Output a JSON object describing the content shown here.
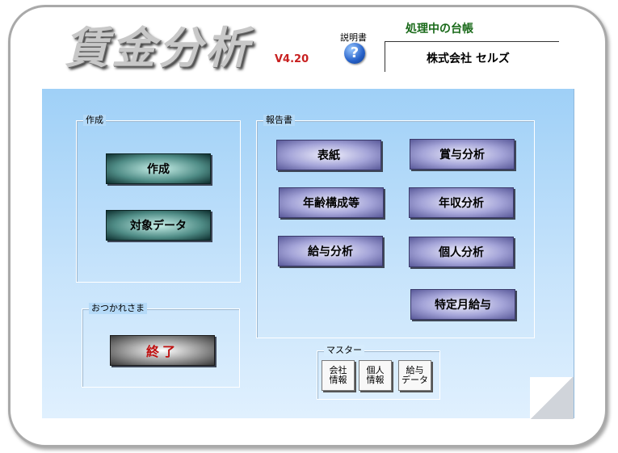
{
  "header": {
    "app_title": "賃金分析",
    "version": "V4.20",
    "help_label": "説明書",
    "help_icon": "question-mark-icon",
    "ledger_label": "処理中の台帳",
    "company_name": "株式会社 セルズ"
  },
  "groups": {
    "create": {
      "label": "作成",
      "buttons": [
        "作成",
        "対象データ"
      ]
    },
    "report": {
      "label": "報告書",
      "buttons": [
        "表紙",
        "年齢構成等",
        "給与分析",
        "賞与分析",
        "年収分析",
        "個人分析",
        "特定月給与"
      ]
    },
    "exit": {
      "label": "おつかれさま",
      "button": "終了"
    },
    "master": {
      "label": "マスター",
      "buttons": [
        "会社\n情報",
        "個人\n情報",
        "給与\nデータ"
      ]
    }
  },
  "colors": {
    "panel_blue": "#b5daf8",
    "create_button": "#4f8c86",
    "report_button": "#a4a4d8",
    "exit_text": "#c01010",
    "version_text": "#c82020",
    "ledger_label": "#1a6a1a"
  }
}
